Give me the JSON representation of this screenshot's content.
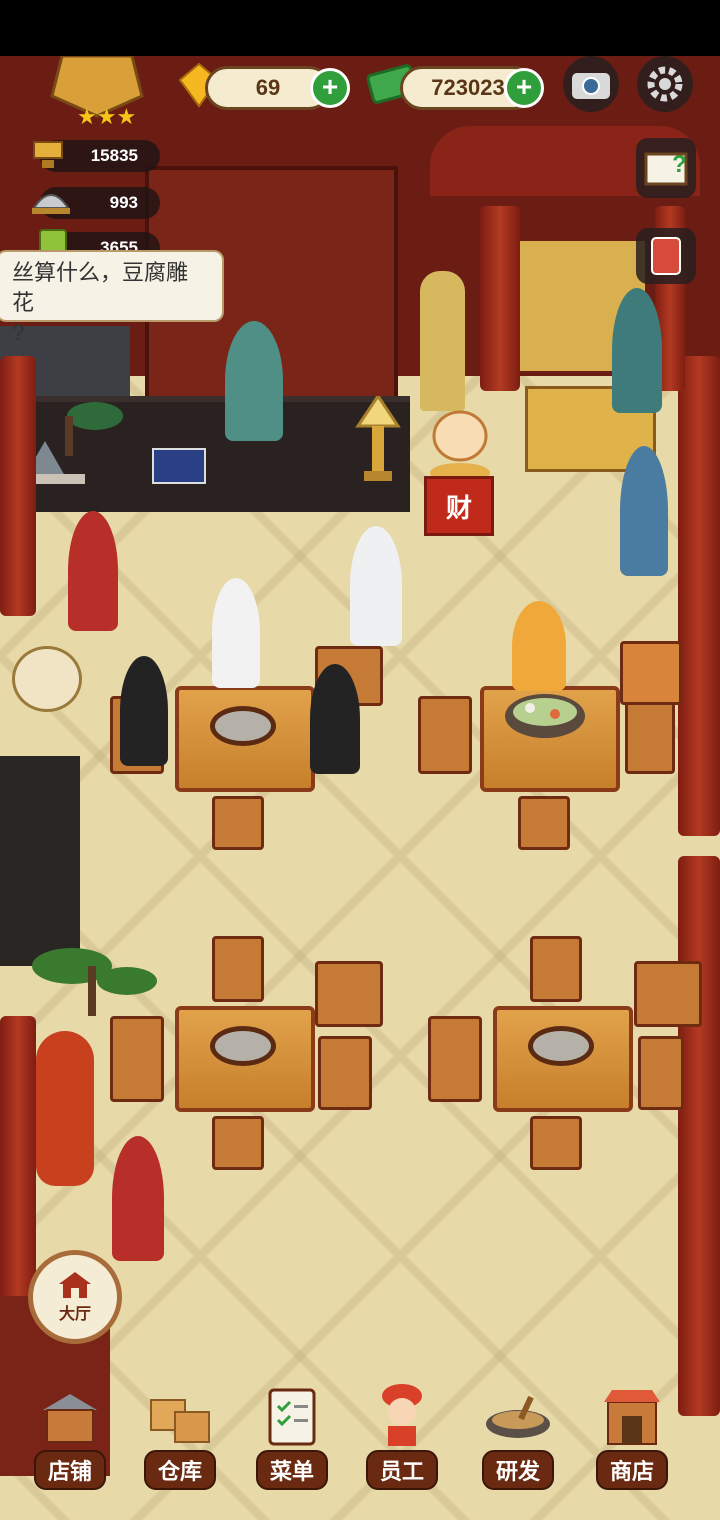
{
  "hud": {
    "diamonds": "69",
    "cash": "723023",
    "rating_stars": 3
  },
  "stats": {
    "reputation": "15835",
    "dishes": "993",
    "menu": "3655"
  },
  "speech_bubble": {
    "line1": "丝算什么，豆腐雕花",
    "line2": "?"
  },
  "scene": {
    "lucky_cat_sign": "财"
  },
  "hall_button": {
    "label": "大厅"
  },
  "bottom_nav": [
    {
      "label": "店铺",
      "icon": "shop-building-icon"
    },
    {
      "label": "仓库",
      "icon": "warehouse-boxes-icon"
    },
    {
      "label": "菜单",
      "icon": "menu-clipboard-icon"
    },
    {
      "label": "员工",
      "icon": "staff-chef-icon"
    },
    {
      "label": "研发",
      "icon": "research-wok-icon"
    },
    {
      "label": "商店",
      "icon": "store-awning-icon"
    }
  ],
  "colors": {
    "plus_button": "#2f9e3b",
    "nav_label_bg": "#6a2a12",
    "wall": "#6b1d14",
    "floor": "#e8d9a9"
  }
}
